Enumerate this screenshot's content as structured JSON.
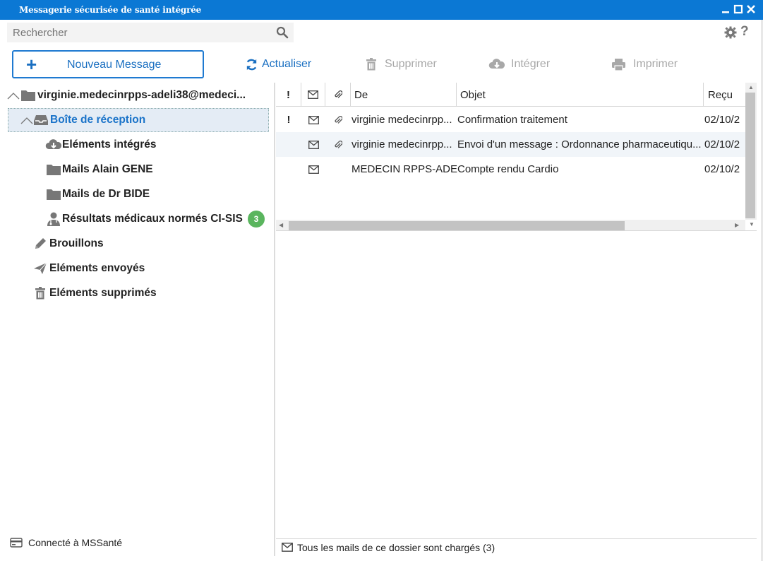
{
  "window": {
    "title": "Messagerie sécurisée de santé intégrée"
  },
  "search": {
    "placeholder": "Rechercher"
  },
  "toolbar": {
    "new_message": "Nouveau Message",
    "refresh": "Actualiser",
    "delete": "Supprimer",
    "integrate": "Intégrer",
    "print": "Imprimer"
  },
  "tree": {
    "account": "virginie.medecinrpps-adeli38@medeci...",
    "inbox": "Boîte de réception",
    "integrated": "Eléments intégrés",
    "folder1": "Mails Alain GENE",
    "folder2": "Mails de Dr BIDE",
    "results": "Résultats médicaux normés CI-SIS",
    "results_count": "3",
    "drafts": "Brouillons",
    "sent": "Eléments envoyés",
    "deleted": "Eléments supprimés"
  },
  "grid": {
    "headers": {
      "flag": "!",
      "from": "De",
      "subject": "Objet",
      "received": "Reçu"
    },
    "rows": [
      {
        "flag": "!",
        "attachment": true,
        "from": "virginie medecinrpp...",
        "subject": "Confirmation traitement",
        "received": "02/10/2"
      },
      {
        "flag": "",
        "attachment": true,
        "from": "virginie medecinrpp...",
        "subject": "Envoi d'un message : Ordonnance pharmaceutiqu...",
        "received": "02/10/2"
      },
      {
        "flag": "",
        "attachment": false,
        "from": "MEDECIN RPPS-ADE...",
        "subject": "Compte rendu Cardio",
        "received": "02/10/2"
      }
    ]
  },
  "status": {
    "connection": "Connecté à MSSanté",
    "loaded": "Tous les mails de ce dossier sont chargés (3)"
  },
  "colors": {
    "accent": "#0b78d4",
    "badge": "#5ab55e"
  }
}
